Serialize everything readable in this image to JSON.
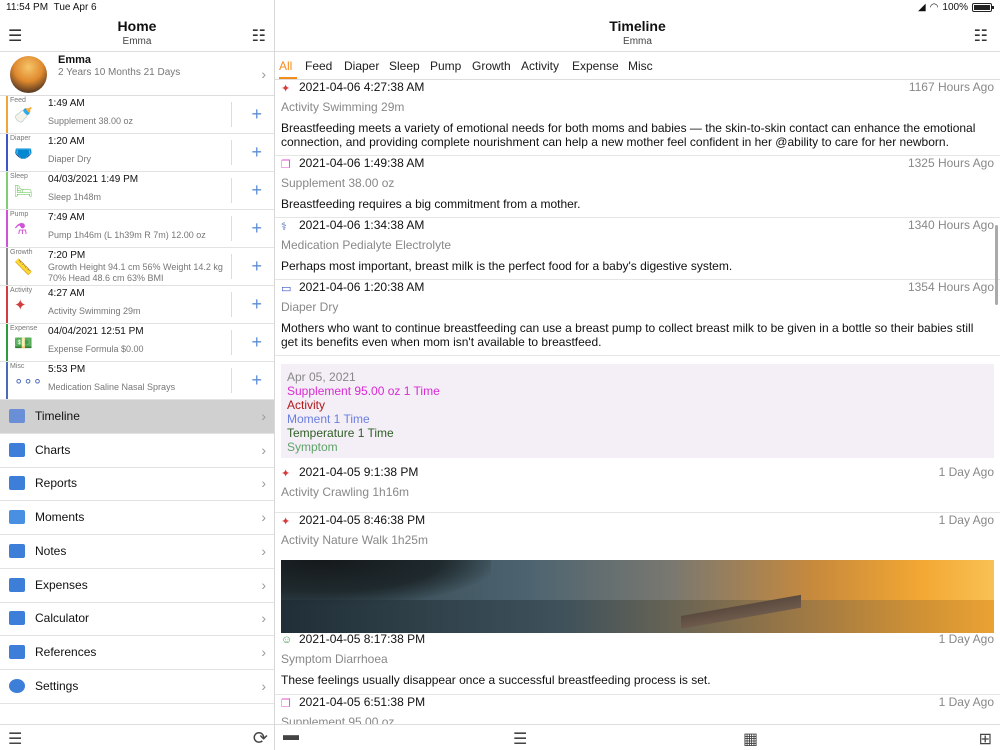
{
  "status": {
    "time": "11:54 PM",
    "date": "Tue Apr 6",
    "battery": "100%"
  },
  "left": {
    "title": "Home",
    "subtitle": "Emma",
    "profile": {
      "name": "Emma",
      "age": "2 Years 10 Months 21 Days"
    },
    "summary": [
      {
        "label": "Feed",
        "time": "1:49 AM",
        "desc": "Supplement 38.00 oz",
        "color": "#f2a43a",
        "icon": "🍼"
      },
      {
        "label": "Diaper",
        "time": "1:20 AM",
        "desc": "Diaper Dry",
        "color": "#3c55c8",
        "icon": "🩲"
      },
      {
        "label": "Sleep",
        "time": "04/03/2021 1:49 PM",
        "desc": "Sleep 1h48m",
        "color": "#7fcf72",
        "icon": "🛏"
      },
      {
        "label": "Pump",
        "time": "7:49 AM",
        "desc": "Pump 1h46m (L 1h39m R 7m) 12.00 oz",
        "color": "#d052d6",
        "icon": "⚗"
      },
      {
        "label": "Growth",
        "time": "7:20 PM",
        "desc": "Growth Height 94.1 cm 56% Weight 14.2 kg 70% Head 48.6 cm 63% BMI",
        "color": "#8a8a8a",
        "icon": "📏"
      },
      {
        "label": "Activity",
        "time": "4:27 AM",
        "desc": "Activity Swimming 29m",
        "color": "#d23d3d",
        "icon": "✦"
      },
      {
        "label": "Expense",
        "time": "04/04/2021 12:51 PM",
        "desc": "Expense Formula $0.00",
        "color": "#2d9b3b",
        "icon": "💵"
      },
      {
        "label": "Misc",
        "time": "5:53 PM",
        "desc": "Medication Saline Nasal Sprays",
        "color": "#4b6bb8",
        "icon": "∘∘∘"
      }
    ],
    "menu": [
      "Timeline",
      "Charts",
      "Reports",
      "Moments",
      "Notes",
      "Expenses",
      "Calculator",
      "References",
      "Settings"
    ]
  },
  "right": {
    "title": "Timeline",
    "subtitle": "Emma",
    "tabs": [
      "All",
      "Feed",
      "Diaper",
      "Sleep",
      "Pump",
      "Growth",
      "Activity",
      "Expense",
      "Misc"
    ],
    "entries": [
      {
        "date": "2021-04-06 4:27:38 AM",
        "ago": "1167 Hours Ago",
        "sub": "Activity Swimming 29m",
        "body": "Breastfeeding meets a variety of emotional needs for both moms and babies — the skin-to-skin contact can enhance the emotional connection, and providing complete nourishment can help a new mother feel confident in her @ability to care for her newborn.",
        "icon": "✦",
        "color": "#d23d3d"
      },
      {
        "date": "2021-04-06 1:49:38 AM",
        "ago": "1325 Hours Ago",
        "sub": "Supplement 38.00 oz",
        "body": "Breastfeeding requires a big commitment from a mother.",
        "icon": "❐",
        "color": "#e04fcf"
      },
      {
        "date": "2021-04-06 1:34:38 AM",
        "ago": "1340 Hours Ago",
        "sub": "Medication Pedialyte Electrolyte",
        "body": "Perhaps most important, breast milk is the perfect food for a baby's digestive system.",
        "icon": "⚕",
        "color": "#4b6bb8"
      },
      {
        "date": "2021-04-06 1:20:38 AM",
        "ago": "1354 Hours Ago",
        "sub": "Diaper Dry",
        "body": "Mothers who want to continue breastfeeding can use a breast pump to collect breast milk to be given in a bottle so their babies still get its benefits even when mom isn't available to breastfeed.",
        "icon": "▭",
        "color": "#3c55c8"
      },
      {
        "date": "2021-04-05 9:1:38 PM",
        "ago": "1 Day Ago",
        "sub": "Activity Crawling 1h16m",
        "body": "",
        "icon": "✦",
        "color": "#d23d3d"
      },
      {
        "date": "2021-04-05 8:46:38 PM",
        "ago": "1 Day Ago",
        "sub": "Activity Nature Walk 1h25m",
        "body": "",
        "icon": "✦",
        "color": "#d23d3d"
      },
      {
        "date": "2021-04-05 8:17:38 PM",
        "ago": "1 Day Ago",
        "sub": "Symptom Diarrhoea",
        "body": "These feelings usually disappear once a successful breastfeeding process is set.",
        "icon": "☺",
        "color": "#3d9b4a"
      },
      {
        "date": "2021-04-05 6:51:38 PM",
        "ago": "1 Day Ago",
        "sub": "Supplement 95.00 oz",
        "body": "",
        "icon": "❐",
        "color": "#e04fcf"
      }
    ],
    "summary_box": {
      "date": "Apr 05, 2021",
      "lines": [
        {
          "text": "Supplement 95.00 oz 1 Time",
          "color": "#d82bd3"
        },
        {
          "text": "Activity",
          "color": "#b01818"
        },
        {
          "text": "Moment 1 Time",
          "color": "#6a7fe0"
        },
        {
          "text": "Temperature 1 Time",
          "color": "#2f5f25"
        },
        {
          "text": "Symptom",
          "color": "#5fa36a"
        }
      ]
    }
  }
}
